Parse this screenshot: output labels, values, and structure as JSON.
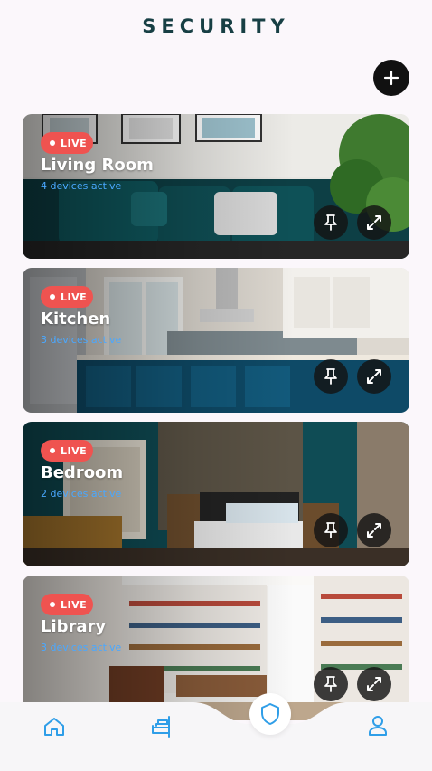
{
  "header": {
    "title": "SECURITY"
  },
  "rooms": [
    {
      "live_label": "LIVE",
      "name": "Living Room",
      "devices": "4 devices active"
    },
    {
      "live_label": "LIVE",
      "name": "Kitchen",
      "devices": "3 devices active"
    },
    {
      "live_label": "LIVE",
      "name": "Bedroom",
      "devices": "2 devices active"
    },
    {
      "live_label": "LIVE",
      "name": "Library",
      "devices": "3 devices active"
    }
  ],
  "icons": {
    "add": "plus-icon",
    "pin": "pin-icon",
    "expand": "expand-icon",
    "nav": [
      "home-icon",
      "sofa-icon",
      "shield-icon",
      "user-icon"
    ]
  },
  "colors": {
    "title": "#173f44",
    "live_badge": "#ef5350",
    "devices_text": "#4aa8ff",
    "nav_accent": "#2f9ee8",
    "background": "#fbf7fb"
  }
}
